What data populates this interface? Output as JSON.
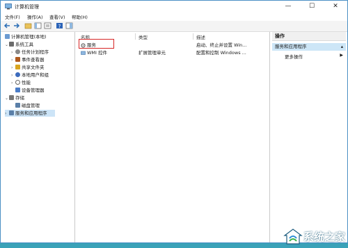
{
  "window": {
    "title": "计算机管理",
    "minimize": "—",
    "maximize": "☐",
    "close": "✕"
  },
  "menu": [
    "文件(F)",
    "操作(A)",
    "查看(V)",
    "帮助(H)"
  ],
  "tree": {
    "root": "计算机管理(本地)",
    "items": [
      {
        "label": "系统工具",
        "color": "#6b6b6b"
      },
      {
        "label": "任务计划程序",
        "color": "#8a8a8a"
      },
      {
        "label": "事件查看器",
        "color": "#b05a1e"
      },
      {
        "label": "共享文件夹",
        "color": "#d9a520"
      },
      {
        "label": "本地用户和组",
        "color": "#3d6bbd"
      },
      {
        "label": "性能",
        "color": "#666666"
      },
      {
        "label": "设备管理器",
        "color": "#4a7cc7"
      },
      {
        "label": "存储",
        "color": "#777777"
      },
      {
        "label": "磁盘管理",
        "color": "#5a7fa8"
      },
      {
        "label": "服务和应用程序",
        "color": "#5a7fa8"
      }
    ]
  },
  "list": {
    "columns": [
      "名称",
      "类型",
      "描述"
    ],
    "rows": [
      {
        "name": "服务",
        "type": "",
        "desc": "启动、终止并设置 Win..."
      },
      {
        "name": "WMI 控件",
        "type": "扩展管理单元",
        "desc": "配置和控制 Windows ..."
      }
    ]
  },
  "actions": {
    "header": "操作",
    "selected": "服务和应用程序",
    "item": "更多操作"
  },
  "watermark": {
    "text": "系统之家"
  }
}
